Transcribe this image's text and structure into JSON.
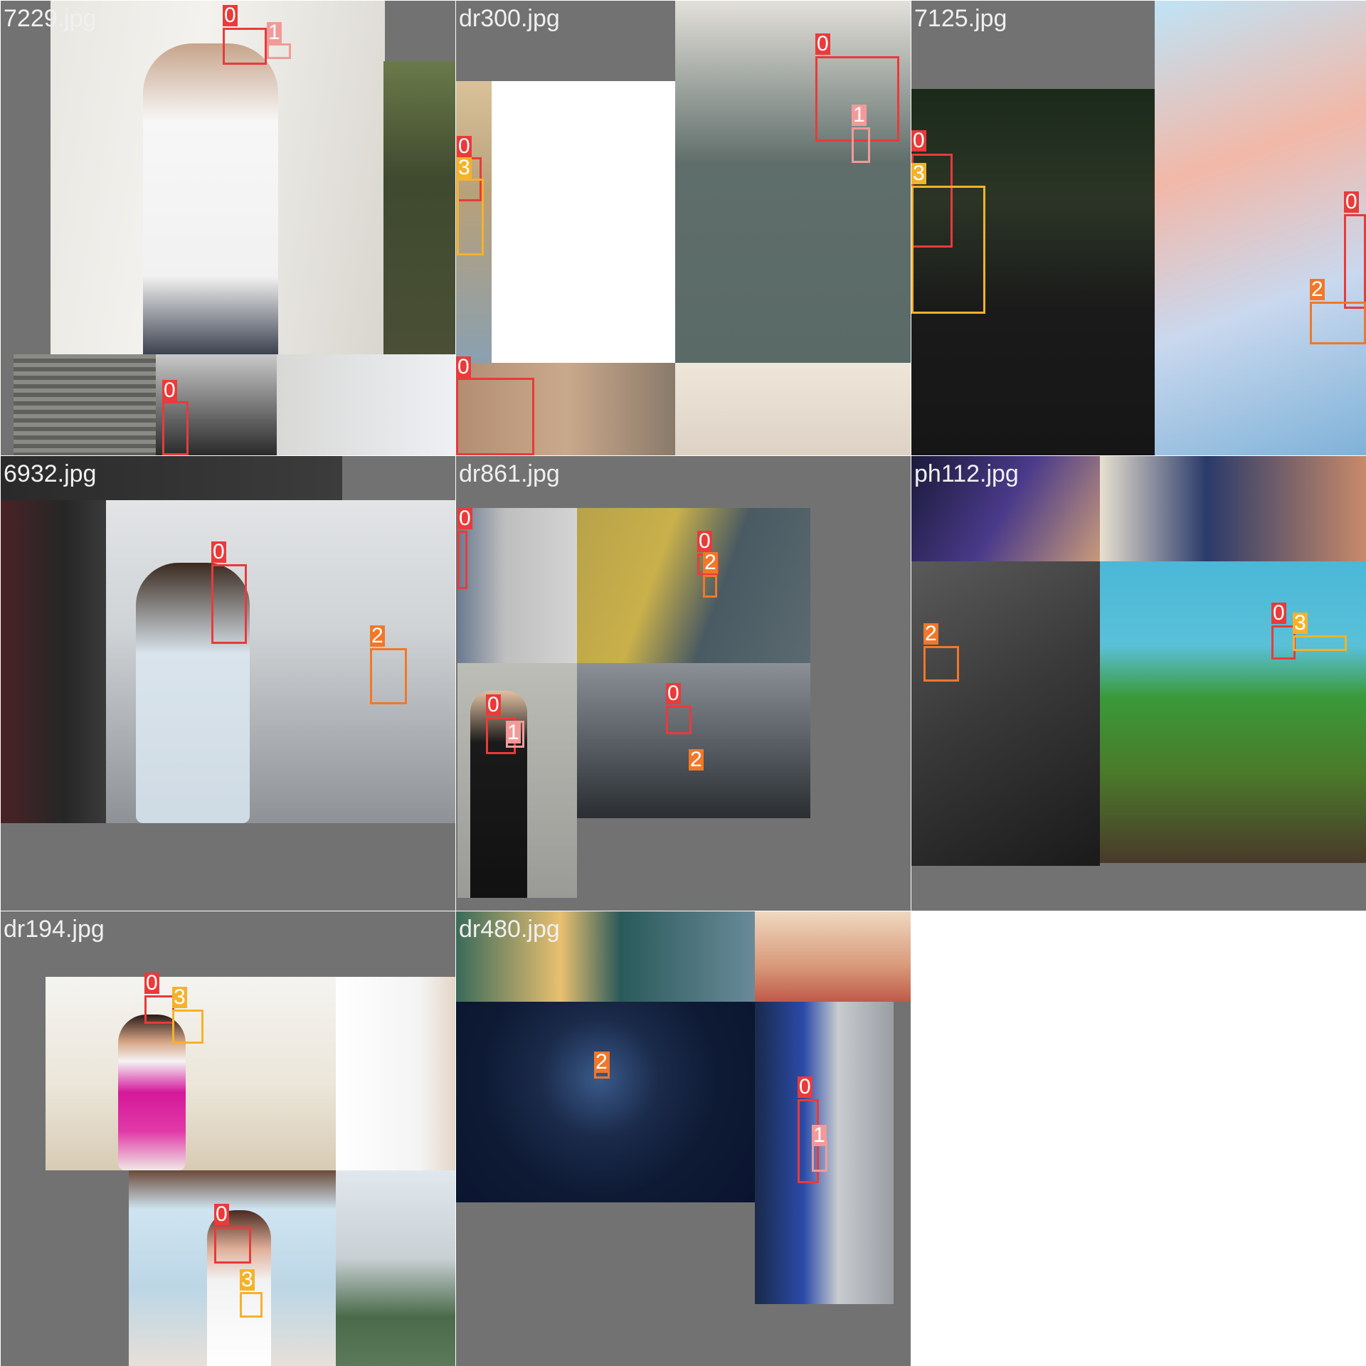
{
  "mosaic": {
    "cells": [
      {
        "filename": "7229.jpg",
        "detections": [
          {
            "label": "0"
          },
          {
            "label": "1"
          },
          {
            "label": "0"
          }
        ]
      },
      {
        "filename": "dr300.jpg",
        "detections": [
          {
            "label": "0"
          },
          {
            "label": "3"
          },
          {
            "label": "0"
          },
          {
            "label": "1"
          },
          {
            "label": "0"
          }
        ]
      },
      {
        "filename": "7125.jpg",
        "detections": [
          {
            "label": "0"
          },
          {
            "label": "3"
          },
          {
            "label": "0"
          },
          {
            "label": "2"
          }
        ]
      },
      {
        "filename": "6932.jpg",
        "detections": [
          {
            "label": "0"
          },
          {
            "label": "2"
          }
        ]
      },
      {
        "filename": "dr861.jpg",
        "detections": [
          {
            "label": "0"
          },
          {
            "label": "0"
          },
          {
            "label": "2"
          },
          {
            "label": "0"
          },
          {
            "label": "1"
          },
          {
            "label": "0"
          },
          {
            "label": "2"
          }
        ]
      },
      {
        "filename": "ph112.jpg",
        "detections": [
          {
            "label": "2"
          },
          {
            "label": "0"
          },
          {
            "label": "3"
          }
        ]
      },
      {
        "filename": "dr194.jpg",
        "detections": [
          {
            "label": "0"
          },
          {
            "label": "3"
          },
          {
            "label": "0"
          },
          {
            "label": "3"
          }
        ]
      },
      {
        "filename": "dr480.jpg",
        "detections": [
          {
            "label": "2"
          },
          {
            "label": "0"
          },
          {
            "label": "1"
          }
        ]
      }
    ]
  },
  "colors": {
    "class_0": "#ea3a3a",
    "class_1": "#f29a9a",
    "class_2": "#f0782a",
    "class_3": "#f5b22a",
    "pad_gray": "#727272"
  }
}
